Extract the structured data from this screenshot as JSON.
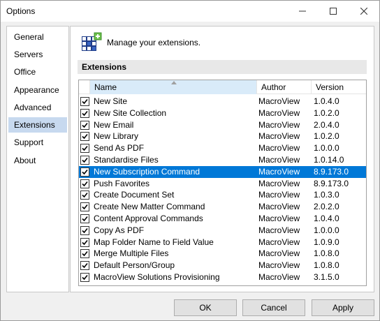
{
  "window": {
    "title": "Options"
  },
  "nav": {
    "items": [
      {
        "label": "General"
      },
      {
        "label": "Servers"
      },
      {
        "label": "Office"
      },
      {
        "label": "Appearance"
      },
      {
        "label": "Advanced"
      },
      {
        "label": "Extensions",
        "selected": true
      },
      {
        "label": "Support"
      },
      {
        "label": "About"
      }
    ]
  },
  "content": {
    "header_text": "Manage your extensions.",
    "section_title": "Extensions",
    "columns": {
      "name": "Name",
      "author": "Author",
      "version": "Version"
    },
    "rows": [
      {
        "name": "New Site",
        "author": "MacroView",
        "version": "1.0.4.0",
        "checked": true
      },
      {
        "name": "New Site Collection",
        "author": "MacroView",
        "version": "1.0.2.0",
        "checked": true
      },
      {
        "name": "New Email",
        "author": "MacroView",
        "version": "2.0.4.0",
        "checked": true
      },
      {
        "name": "New Library",
        "author": "MacroView",
        "version": "1.0.2.0",
        "checked": true
      },
      {
        "name": "Send As PDF",
        "author": "MacroView",
        "version": "1.0.0.0",
        "checked": true
      },
      {
        "name": "Standardise Files",
        "author": "MacroView",
        "version": "1.0.14.0",
        "checked": true
      },
      {
        "name": "New Subscription Command",
        "author": "MacroView",
        "version": "8.9.173.0",
        "checked": true,
        "selected": true
      },
      {
        "name": "Push Favorites",
        "author": "MacroView",
        "version": "8.9.173.0",
        "checked": true
      },
      {
        "name": "Create Document Set",
        "author": "MacroView",
        "version": "1.0.3.0",
        "checked": true
      },
      {
        "name": "Create New Matter Command",
        "author": "MacroView",
        "version": "2.0.2.0",
        "checked": true
      },
      {
        "name": "Content Approval Commands",
        "author": "MacroView",
        "version": "1.0.4.0",
        "checked": true
      },
      {
        "name": "Copy As PDF",
        "author": "MacroView",
        "version": "1.0.0.0",
        "checked": true
      },
      {
        "name": "Map Folder Name to Field Value",
        "author": "MacroView",
        "version": "1.0.9.0",
        "checked": true
      },
      {
        "name": "Merge Multiple Files",
        "author": "MacroView",
        "version": "1.0.8.0",
        "checked": true
      },
      {
        "name": "Default Person/Group",
        "author": "MacroView",
        "version": "1.0.8.0",
        "checked": true
      },
      {
        "name": "MacroView Solutions Provisioning",
        "author": "MacroView",
        "version": "3.1.5.0",
        "checked": true
      }
    ]
  },
  "buttons": {
    "ok": "OK",
    "cancel": "Cancel",
    "apply": "Apply"
  },
  "colors": {
    "selection": "#0078d7",
    "nav_selected": "#c7d9ef"
  }
}
